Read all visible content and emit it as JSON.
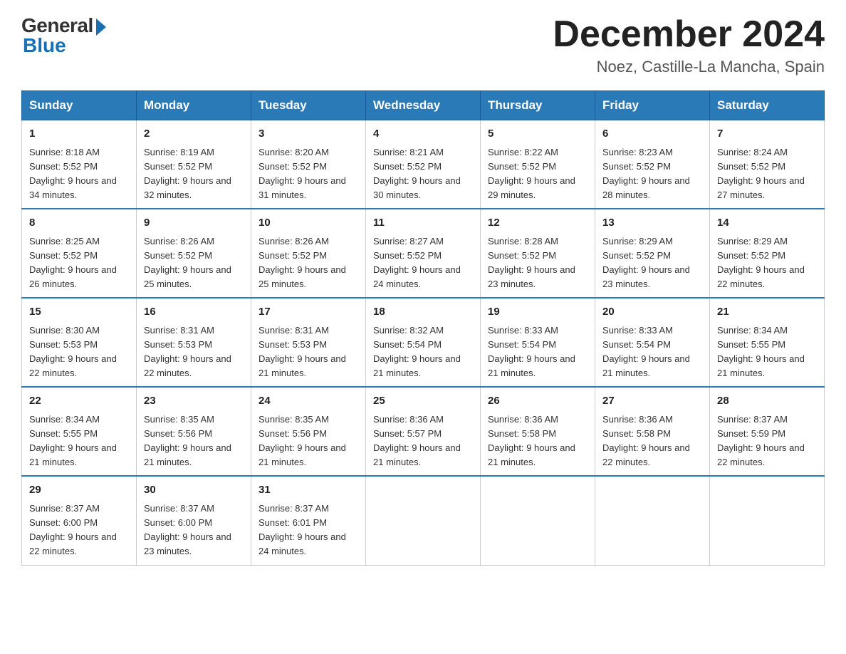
{
  "header": {
    "logo_general": "General",
    "logo_blue": "Blue",
    "month_title": "December 2024",
    "location": "Noez, Castille-La Mancha, Spain"
  },
  "weekdays": [
    "Sunday",
    "Monday",
    "Tuesday",
    "Wednesday",
    "Thursday",
    "Friday",
    "Saturday"
  ],
  "weeks": [
    [
      {
        "day": "1",
        "sunrise": "8:18 AM",
        "sunset": "5:52 PM",
        "daylight": "9 hours and 34 minutes."
      },
      {
        "day": "2",
        "sunrise": "8:19 AM",
        "sunset": "5:52 PM",
        "daylight": "9 hours and 32 minutes."
      },
      {
        "day": "3",
        "sunrise": "8:20 AM",
        "sunset": "5:52 PM",
        "daylight": "9 hours and 31 minutes."
      },
      {
        "day": "4",
        "sunrise": "8:21 AM",
        "sunset": "5:52 PM",
        "daylight": "9 hours and 30 minutes."
      },
      {
        "day": "5",
        "sunrise": "8:22 AM",
        "sunset": "5:52 PM",
        "daylight": "9 hours and 29 minutes."
      },
      {
        "day": "6",
        "sunrise": "8:23 AM",
        "sunset": "5:52 PM",
        "daylight": "9 hours and 28 minutes."
      },
      {
        "day": "7",
        "sunrise": "8:24 AM",
        "sunset": "5:52 PM",
        "daylight": "9 hours and 27 minutes."
      }
    ],
    [
      {
        "day": "8",
        "sunrise": "8:25 AM",
        "sunset": "5:52 PM",
        "daylight": "9 hours and 26 minutes."
      },
      {
        "day": "9",
        "sunrise": "8:26 AM",
        "sunset": "5:52 PM",
        "daylight": "9 hours and 25 minutes."
      },
      {
        "day": "10",
        "sunrise": "8:26 AM",
        "sunset": "5:52 PM",
        "daylight": "9 hours and 25 minutes."
      },
      {
        "day": "11",
        "sunrise": "8:27 AM",
        "sunset": "5:52 PM",
        "daylight": "9 hours and 24 minutes."
      },
      {
        "day": "12",
        "sunrise": "8:28 AM",
        "sunset": "5:52 PM",
        "daylight": "9 hours and 23 minutes."
      },
      {
        "day": "13",
        "sunrise": "8:29 AM",
        "sunset": "5:52 PM",
        "daylight": "9 hours and 23 minutes."
      },
      {
        "day": "14",
        "sunrise": "8:29 AM",
        "sunset": "5:52 PM",
        "daylight": "9 hours and 22 minutes."
      }
    ],
    [
      {
        "day": "15",
        "sunrise": "8:30 AM",
        "sunset": "5:53 PM",
        "daylight": "9 hours and 22 minutes."
      },
      {
        "day": "16",
        "sunrise": "8:31 AM",
        "sunset": "5:53 PM",
        "daylight": "9 hours and 22 minutes."
      },
      {
        "day": "17",
        "sunrise": "8:31 AM",
        "sunset": "5:53 PM",
        "daylight": "9 hours and 21 minutes."
      },
      {
        "day": "18",
        "sunrise": "8:32 AM",
        "sunset": "5:54 PM",
        "daylight": "9 hours and 21 minutes."
      },
      {
        "day": "19",
        "sunrise": "8:33 AM",
        "sunset": "5:54 PM",
        "daylight": "9 hours and 21 minutes."
      },
      {
        "day": "20",
        "sunrise": "8:33 AM",
        "sunset": "5:54 PM",
        "daylight": "9 hours and 21 minutes."
      },
      {
        "day": "21",
        "sunrise": "8:34 AM",
        "sunset": "5:55 PM",
        "daylight": "9 hours and 21 minutes."
      }
    ],
    [
      {
        "day": "22",
        "sunrise": "8:34 AM",
        "sunset": "5:55 PM",
        "daylight": "9 hours and 21 minutes."
      },
      {
        "day": "23",
        "sunrise": "8:35 AM",
        "sunset": "5:56 PM",
        "daylight": "9 hours and 21 minutes."
      },
      {
        "day": "24",
        "sunrise": "8:35 AM",
        "sunset": "5:56 PM",
        "daylight": "9 hours and 21 minutes."
      },
      {
        "day": "25",
        "sunrise": "8:36 AM",
        "sunset": "5:57 PM",
        "daylight": "9 hours and 21 minutes."
      },
      {
        "day": "26",
        "sunrise": "8:36 AM",
        "sunset": "5:58 PM",
        "daylight": "9 hours and 21 minutes."
      },
      {
        "day": "27",
        "sunrise": "8:36 AM",
        "sunset": "5:58 PM",
        "daylight": "9 hours and 22 minutes."
      },
      {
        "day": "28",
        "sunrise": "8:37 AM",
        "sunset": "5:59 PM",
        "daylight": "9 hours and 22 minutes."
      }
    ],
    [
      {
        "day": "29",
        "sunrise": "8:37 AM",
        "sunset": "6:00 PM",
        "daylight": "9 hours and 22 minutes."
      },
      {
        "day": "30",
        "sunrise": "8:37 AM",
        "sunset": "6:00 PM",
        "daylight": "9 hours and 23 minutes."
      },
      {
        "day": "31",
        "sunrise": "8:37 AM",
        "sunset": "6:01 PM",
        "daylight": "9 hours and 24 minutes."
      },
      null,
      null,
      null,
      null
    ]
  ]
}
